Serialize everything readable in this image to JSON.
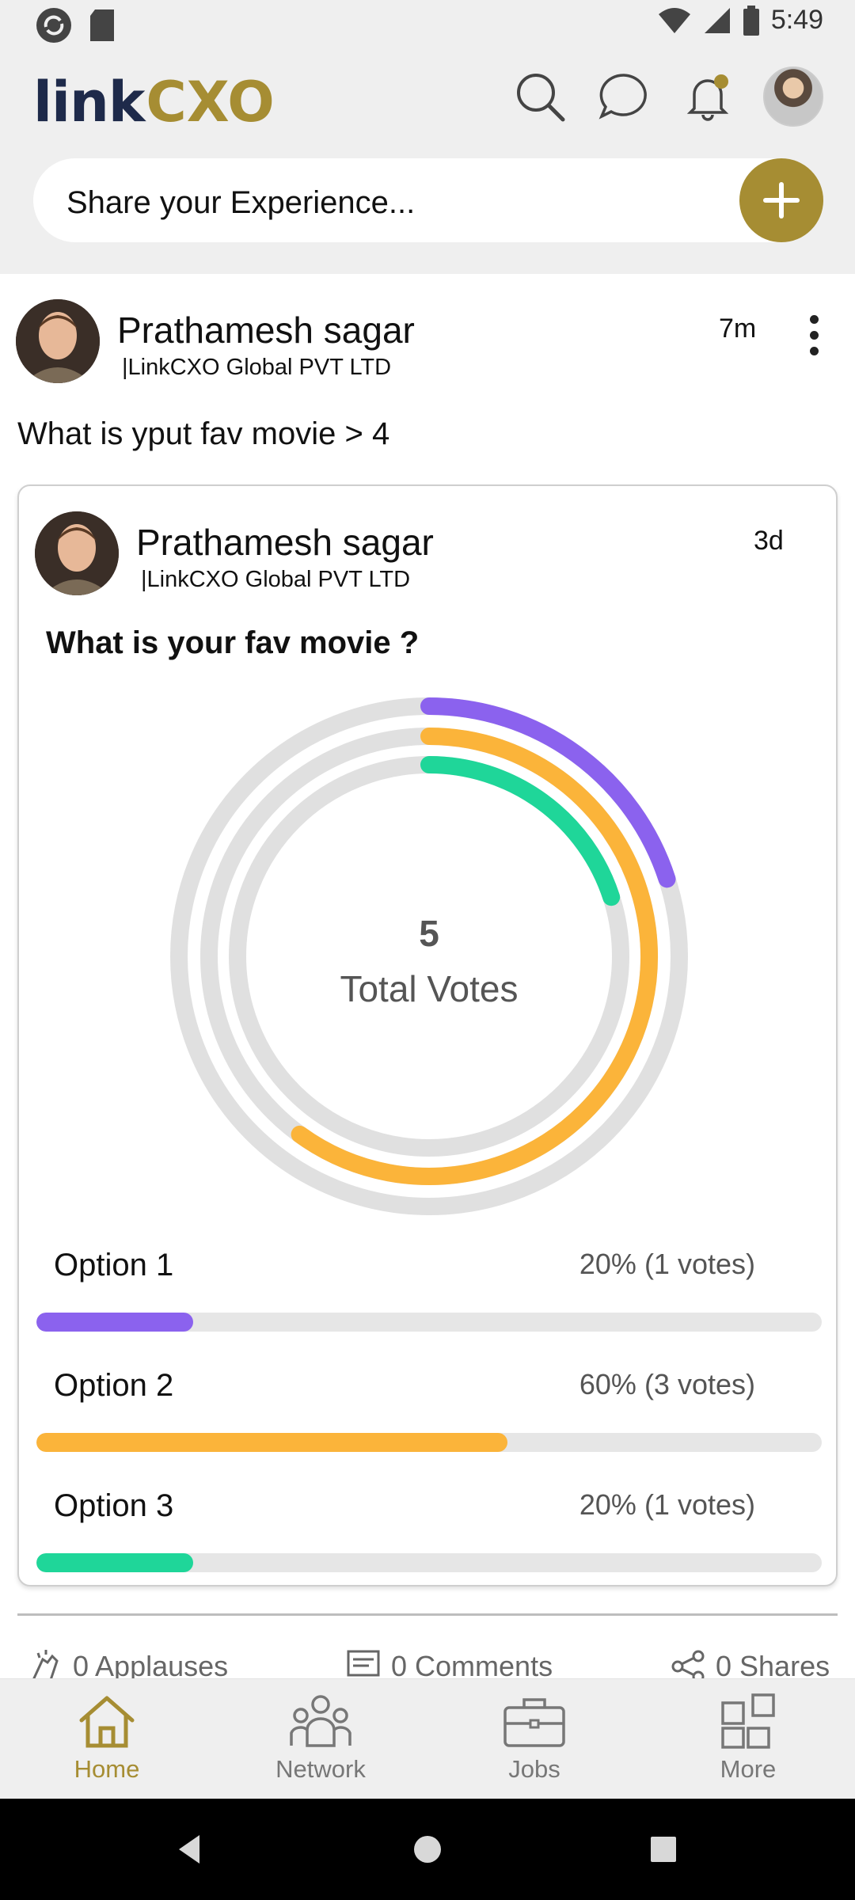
{
  "status_bar": {
    "time": "5:49",
    "icons": [
      "sync-icon",
      "sd-card-icon",
      "wifi-icon",
      "signal-icon",
      "battery-icon"
    ]
  },
  "header": {
    "logo_prefix": "link",
    "logo_suffix": "CXO",
    "icons": [
      "search-icon",
      "chat-icon",
      "bell-icon",
      "profile-avatar"
    ]
  },
  "share": {
    "placeholder": "Share your Experience..."
  },
  "post": {
    "author": "Prathamesh sagar",
    "org": "|LinkCXO Global PVT LTD",
    "time": "7m",
    "text": "What is yput fav movie > 4",
    "poll": {
      "author": "Prathamesh sagar",
      "org": "|LinkCXO Global PVT LTD",
      "time": "3d",
      "question": "What is your fav movie ?",
      "total_votes": "5",
      "total_label": "Total Votes",
      "options": [
        {
          "label": "Option 1",
          "stat": "20% (1 votes)",
          "fraction": 0.2,
          "color": "#8b62ee"
        },
        {
          "label": "Option 2",
          "stat": "60% (3 votes)",
          "fraction": 0.6,
          "color": "#fbb43a"
        },
        {
          "label": "Option 3",
          "stat": "20% (1 votes)",
          "fraction": 0.2,
          "color": "#1fd699"
        }
      ]
    },
    "actions": {
      "applauses": "0 Applauses",
      "comments": "0 Comments",
      "shares": "0 Shares"
    }
  },
  "bottom_nav": {
    "items": [
      {
        "label": "Home",
        "active": true
      },
      {
        "label": "Network",
        "active": false
      },
      {
        "label": "Jobs",
        "active": false
      },
      {
        "label": "More",
        "active": false
      }
    ]
  },
  "colors": {
    "brand_gold": "#a68d33",
    "brand_navy": "#1e2a4a"
  }
}
